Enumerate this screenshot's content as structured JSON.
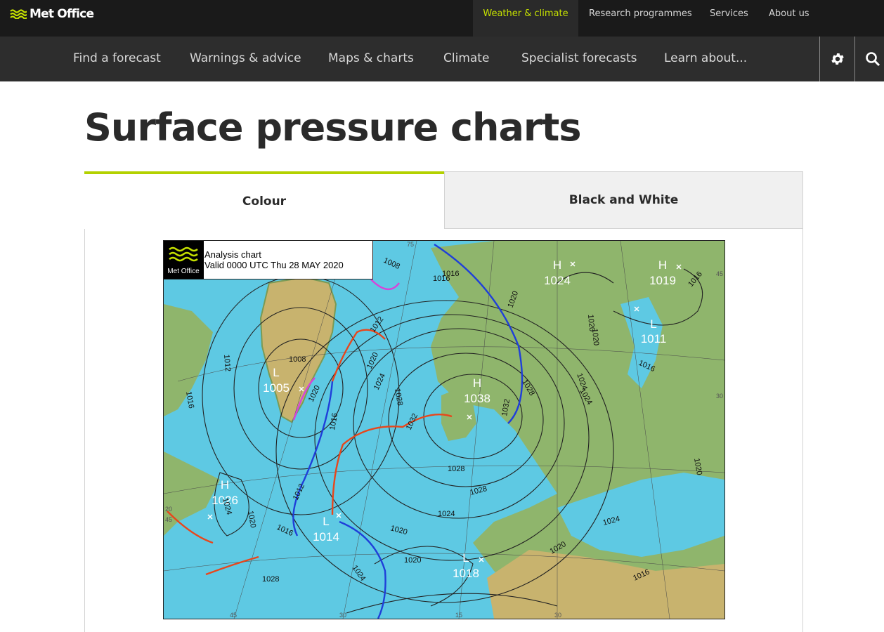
{
  "brand": {
    "name": "Met Office"
  },
  "utility_nav": [
    {
      "label": "Weather & climate",
      "active": true
    },
    {
      "label": "Research programmes"
    },
    {
      "label": "Services"
    },
    {
      "label": "About us"
    }
  ],
  "main_nav": [
    {
      "label": "Find a forecast"
    },
    {
      "label": "Warnings & advice"
    },
    {
      "label": "Maps & charts"
    },
    {
      "label": "Climate"
    },
    {
      "label": "Specialist forecasts"
    },
    {
      "label": "Learn about..."
    }
  ],
  "icons": {
    "settings": "gear-icon",
    "search": "search-icon"
  },
  "colors": {
    "accent": "#b3d100",
    "nav_bg": "#2d2d2d",
    "top_bg": "#1a1a1a",
    "sea": "#5ec9e3",
    "land": "#8fb56c",
    "warm_front": "#e8461b",
    "cold_front": "#1f3fd9",
    "occluded": "#d545d9"
  },
  "page": {
    "title": "Surface pressure charts"
  },
  "tabs": [
    {
      "label": "Colour",
      "active": true
    },
    {
      "label": "Black and White"
    }
  ],
  "chart": {
    "logo_text": "Met Office",
    "line1": "Analysis chart",
    "line2": "Valid 0000 UTC Thu 28 MAY 2020",
    "centres": [
      {
        "type": "H",
        "value": "1024"
      },
      {
        "type": "H",
        "value": "1019"
      },
      {
        "type": "L",
        "value": "1011"
      },
      {
        "type": "L",
        "value": "1005"
      },
      {
        "type": "H",
        "value": "1038"
      },
      {
        "type": "H",
        "value": "1026"
      },
      {
        "type": "L",
        "value": "1014"
      },
      {
        "type": "L",
        "value": "1018"
      }
    ],
    "isobar_labels": [
      "1008",
      "1016",
      "1020",
      "1012",
      "1020",
      "1024",
      "1028",
      "1032",
      "1016",
      "1008",
      "1012",
      "1016",
      "1020",
      "1024",
      "1028",
      "1032",
      "1024",
      "1020",
      "1016",
      "1028",
      "1012",
      "1016",
      "1020",
      "1024",
      "1028",
      "1024",
      "1020",
      "1020",
      "1024",
      "1020",
      "1016",
      "1016",
      "1020",
      "1024",
      "1020",
      "1028",
      "1016"
    ],
    "grid_labels": [
      "75",
      "45",
      "30",
      "45",
      "30",
      "15",
      "30",
      "20",
      "45"
    ]
  }
}
